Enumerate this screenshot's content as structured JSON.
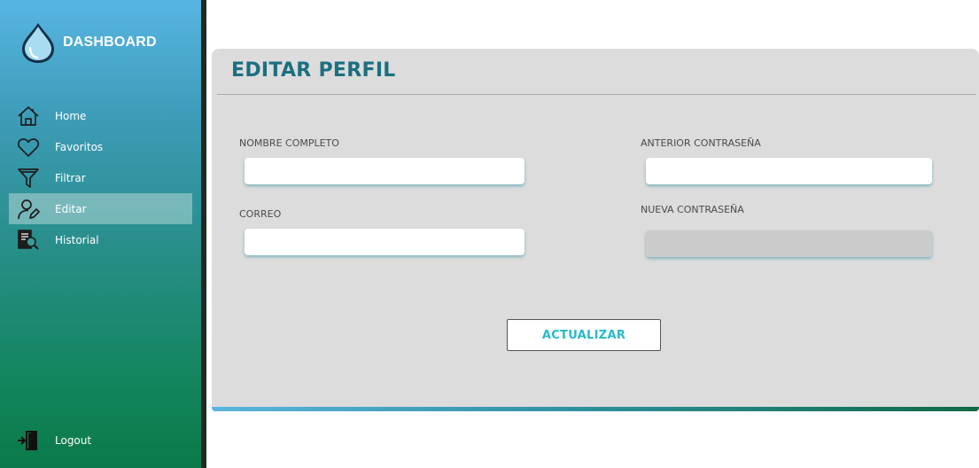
{
  "app": {
    "title": "DASHBOARD",
    "logo_icon": "water-drop-icon"
  },
  "sidebar": {
    "items": [
      {
        "label": "Home",
        "icon": "home-icon"
      },
      {
        "label": "Favoritos",
        "icon": "heart-icon"
      },
      {
        "label": "Filtrar",
        "icon": "filter-icon"
      },
      {
        "label": "Editar",
        "icon": "user-edit-icon",
        "active": true
      },
      {
        "label": "Historial",
        "icon": "history-search-icon"
      }
    ],
    "logout": {
      "label": "Logout",
      "icon": "logout-door-icon"
    }
  },
  "main": {
    "title": "EDITAR PERFIL",
    "fields": {
      "full_name": {
        "label": "NOMBRE COMPLETO",
        "value": ""
      },
      "email": {
        "label": "CORREO",
        "value": ""
      },
      "old_password": {
        "label": "ANTERIOR CONTRASEÑA",
        "value": ""
      },
      "new_password": {
        "label": "NUEVA CONTRASEÑA",
        "value": "",
        "disabled": true
      }
    },
    "submit_label": "ACTUALIZAR"
  },
  "colors": {
    "sidebar_top": "#57b5e3",
    "sidebar_bottom": "#0b7a48",
    "title": "#1b6f80",
    "button_text": "#28b9c9",
    "panel_bg": "#dcdcdc"
  }
}
